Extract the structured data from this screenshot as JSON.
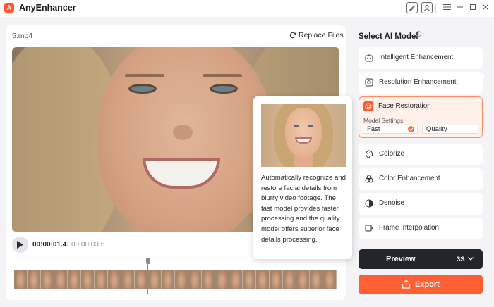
{
  "app": {
    "logo_letter": "A",
    "title": "AnyEnhancer"
  },
  "titlebar": {
    "icons": [
      "feedback-icon",
      "account-icon",
      "menu-icon",
      "minimize-icon",
      "maximize-icon",
      "close-icon"
    ]
  },
  "video": {
    "file_name": "5.mp4",
    "replace_label": "Replace Files",
    "current_time": "00:00:01.4",
    "time_separator": "/",
    "total_time": "00:00:03.5"
  },
  "tooltip": {
    "text": "Automatically recognize and restore facial details from blurry video footage. The fast model provides faster processing and the quality model offers superior face details processing."
  },
  "models": {
    "title": "Select AI Model",
    "info_icon": "i",
    "items": [
      {
        "label": "Intelligent Enhancement",
        "icon": "robot-icon"
      },
      {
        "label": "Resolution Enhancement",
        "icon": "resolution-icon"
      },
      {
        "label": "Face Restoration",
        "icon": "face-icon"
      },
      {
        "label": "Colorize",
        "icon": "palette-icon"
      },
      {
        "label": "Color Enhancement",
        "icon": "color-circles-icon"
      },
      {
        "label": "Denoise",
        "icon": "denoise-icon"
      },
      {
        "label": "Frame Interpolation",
        "icon": "frame-icon"
      }
    ],
    "selected": "Face Restoration",
    "settings_label": "Model Settings",
    "options": {
      "fast": "Fast",
      "quality": "Quality",
      "selected": "Fast"
    }
  },
  "actions": {
    "preview_label": "Preview",
    "preview_duration": "3S",
    "export_label": "Export"
  },
  "colors": {
    "accent": "#ff5f34",
    "dark_button": "#23252c",
    "selected_bg": "#fff0ea"
  }
}
